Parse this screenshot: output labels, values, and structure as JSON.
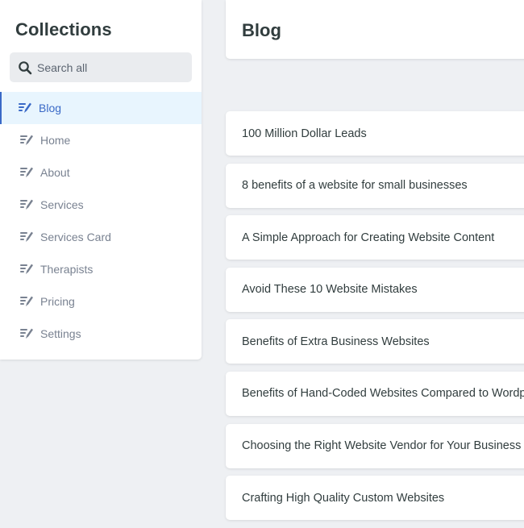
{
  "sidebar": {
    "title": "Collections",
    "search": {
      "placeholder": "Search all",
      "value": ""
    },
    "items": [
      {
        "label": "Blog",
        "active": true
      },
      {
        "label": "Home",
        "active": false
      },
      {
        "label": "About",
        "active": false
      },
      {
        "label": "Services",
        "active": false
      },
      {
        "label": "Services Card",
        "active": false
      },
      {
        "label": "Therapists",
        "active": false
      },
      {
        "label": "Pricing",
        "active": false
      },
      {
        "label": "Settings",
        "active": false
      }
    ]
  },
  "main": {
    "title": "Blog",
    "entries": [
      "100 Million Dollar Leads",
      "8 benefits of a website for small businesses",
      "A Simple Approach for Creating Website Content",
      "Avoid These 10 Website Mistakes",
      "Benefits of Extra Business Websites",
      "Benefits of Hand-Coded Websites Compared to Wordpress",
      "Choosing the Right Website Vendor for Your Business",
      "Crafting High Quality Custom Websites"
    ]
  },
  "icons": {
    "search": "search-icon",
    "collection": "write-icon"
  },
  "colors": {
    "background": "#eef0f3",
    "accent": "#3a69c7",
    "active_bg": "#e8f5fe",
    "muted_text": "#798291",
    "text": "#313d3e"
  }
}
